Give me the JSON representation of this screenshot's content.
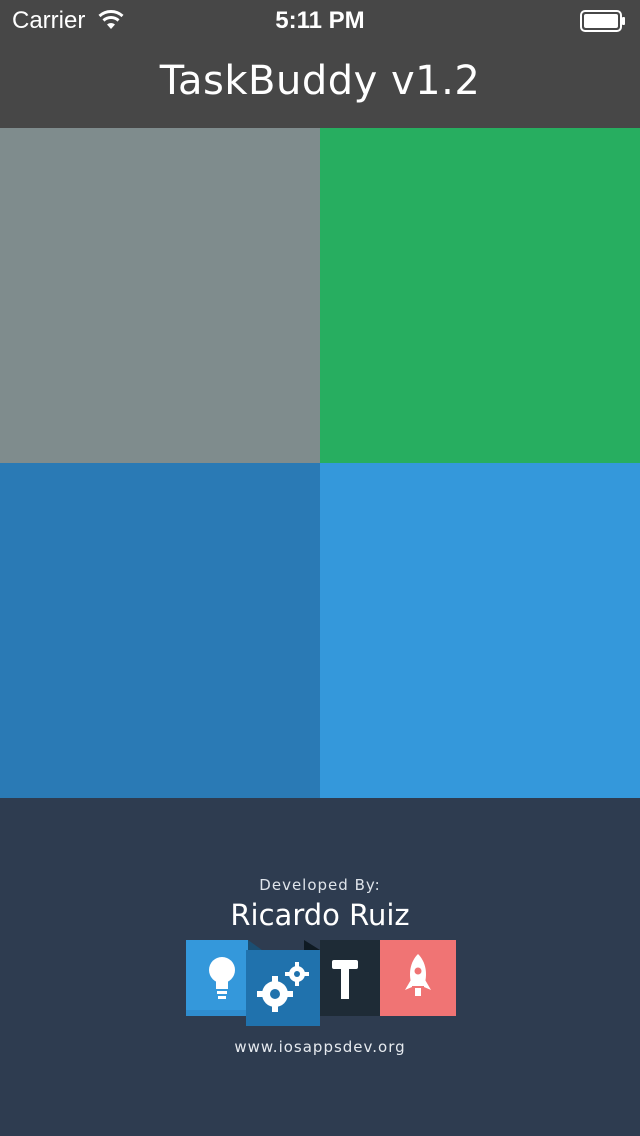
{
  "status": {
    "carrier": "Carrier",
    "time": "5:11 PM"
  },
  "nav": {
    "title": "TaskBuddy v1.2"
  },
  "tiles": [
    {
      "color": "#7f8c8d"
    },
    {
      "color": "#27ae60"
    },
    {
      "color": "#2a7ab5"
    },
    {
      "color": "#3498db"
    }
  ],
  "footer": {
    "developed_by_label": "Developed By:",
    "developer_name": "Ricardo Ruiz",
    "website": "www.iosappsdev.org"
  },
  "logo_icons": [
    "lightbulb-icon",
    "gears-icon",
    "hammer-icon",
    "rocket-icon"
  ]
}
